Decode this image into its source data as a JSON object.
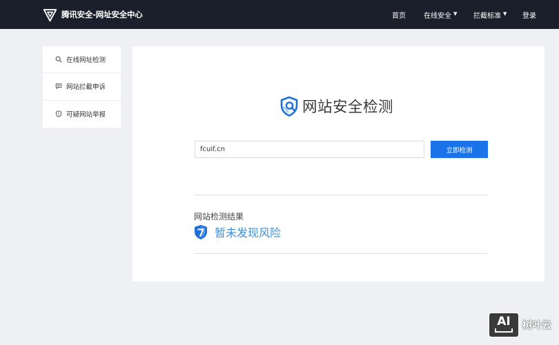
{
  "header": {
    "brand_name": "腾讯安全-网址安全中心",
    "nav": {
      "home": "首页",
      "online_security": "在线安全",
      "block_standard": "拦截标准",
      "login": "登录"
    }
  },
  "sidebar": {
    "items": [
      {
        "label": "在线网址检测",
        "icon": "search-icon"
      },
      {
        "label": "网站拦截申诉",
        "icon": "chat-icon"
      },
      {
        "label": "可疑网站举报",
        "icon": "shield-alert-icon"
      }
    ]
  },
  "main": {
    "title": "网站安全检测",
    "url_input_value": "fcuif.cn",
    "check_button": "立即检测",
    "result_heading": "网站检测结果",
    "result_text": "暂未发现风险"
  },
  "watermark": {
    "badge": "AI",
    "text": "树叶云"
  },
  "colors": {
    "header_bg": "#1b1e2b",
    "page_bg": "#eef0f4",
    "accent_blue": "#1a73e8",
    "safe_blue": "#3f8fd6"
  }
}
